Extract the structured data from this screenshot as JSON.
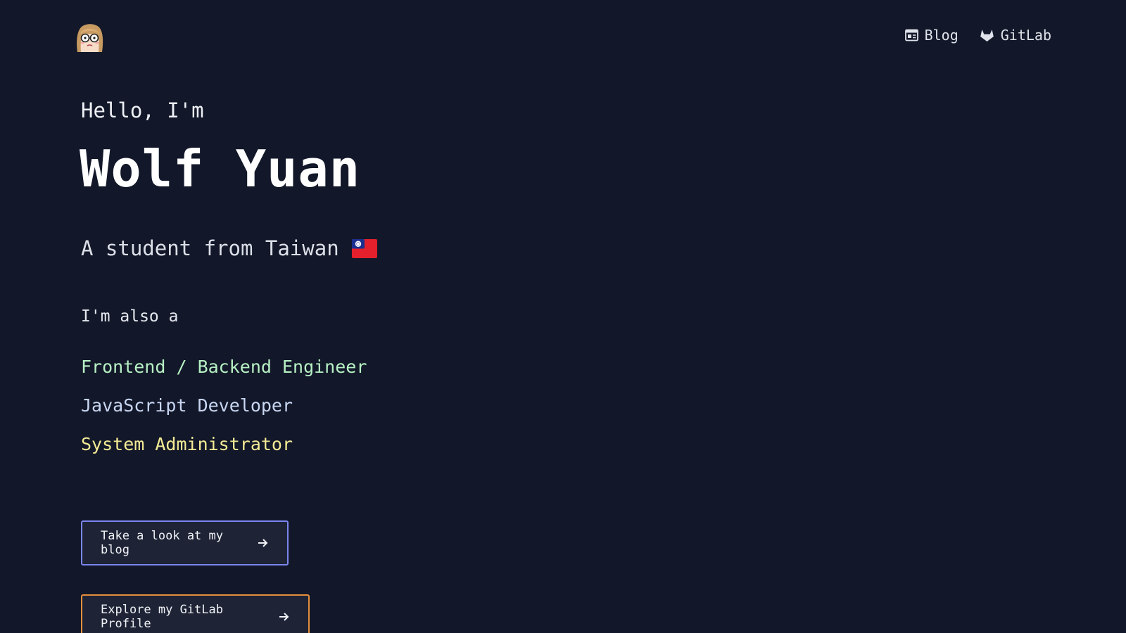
{
  "header": {
    "avatar_icon": "avatar-glasses-girl-icon",
    "nav": [
      {
        "label": "Blog",
        "icon": "newspaper-icon"
      },
      {
        "label": "GitLab",
        "icon": "gitlab-icon"
      }
    ]
  },
  "hero": {
    "greeting": "Hello, I'm",
    "name": "Wolf Yuan",
    "tagline": "A student from Taiwan",
    "flag_icon": "taiwan-flag-icon",
    "also_label": "I'm also a",
    "roles": [
      {
        "label": "Frontend / Backend Engineer",
        "color": "#b7f0c4"
      },
      {
        "label": "JavaScript Developer",
        "color": "#c8d6f2"
      },
      {
        "label": "System Administrator",
        "color": "#f4ea96"
      }
    ]
  },
  "buttons": {
    "blog": {
      "label": "Take a look at my blog",
      "border_color": "#7c86ee",
      "icon": "arrow-right-icon"
    },
    "gitlab": {
      "label": "Explore my GitLab Profile",
      "border_color": "#e58e3c",
      "icon": "arrow-right-icon"
    }
  },
  "colors": {
    "background": "#121829",
    "button_background": "#1e2436"
  }
}
